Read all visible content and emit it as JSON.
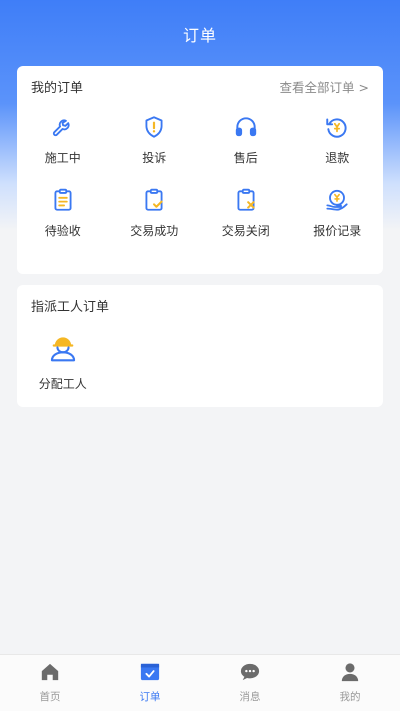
{
  "header": {
    "title": "订单"
  },
  "my_orders": {
    "title": "我的订单",
    "view_all": "查看全部订单 >",
    "items": [
      {
        "label": "施工中",
        "icon": "wrench-icon"
      },
      {
        "label": "投诉",
        "icon": "shield-alert-icon"
      },
      {
        "label": "售后",
        "icon": "headset-icon"
      },
      {
        "label": "退款",
        "icon": "refund-icon"
      },
      {
        "label": "待验收",
        "icon": "clipboard-icon"
      },
      {
        "label": "交易成功",
        "icon": "clipboard-check-icon"
      },
      {
        "label": "交易关闭",
        "icon": "clipboard-close-icon"
      },
      {
        "label": "报价记录",
        "icon": "quote-record-icon"
      }
    ]
  },
  "assign_orders": {
    "title": "指派工人订单",
    "items": [
      {
        "label": "分配工人",
        "icon": "worker-icon"
      }
    ]
  },
  "tabbar": {
    "items": [
      {
        "label": "首页",
        "icon": "home-icon"
      },
      {
        "label": "订单",
        "icon": "order-icon"
      },
      {
        "label": "消息",
        "icon": "message-icon"
      },
      {
        "label": "我的",
        "icon": "user-icon"
      }
    ]
  },
  "colors": {
    "primary": "#3a78f2",
    "accent": "#f5b724"
  }
}
